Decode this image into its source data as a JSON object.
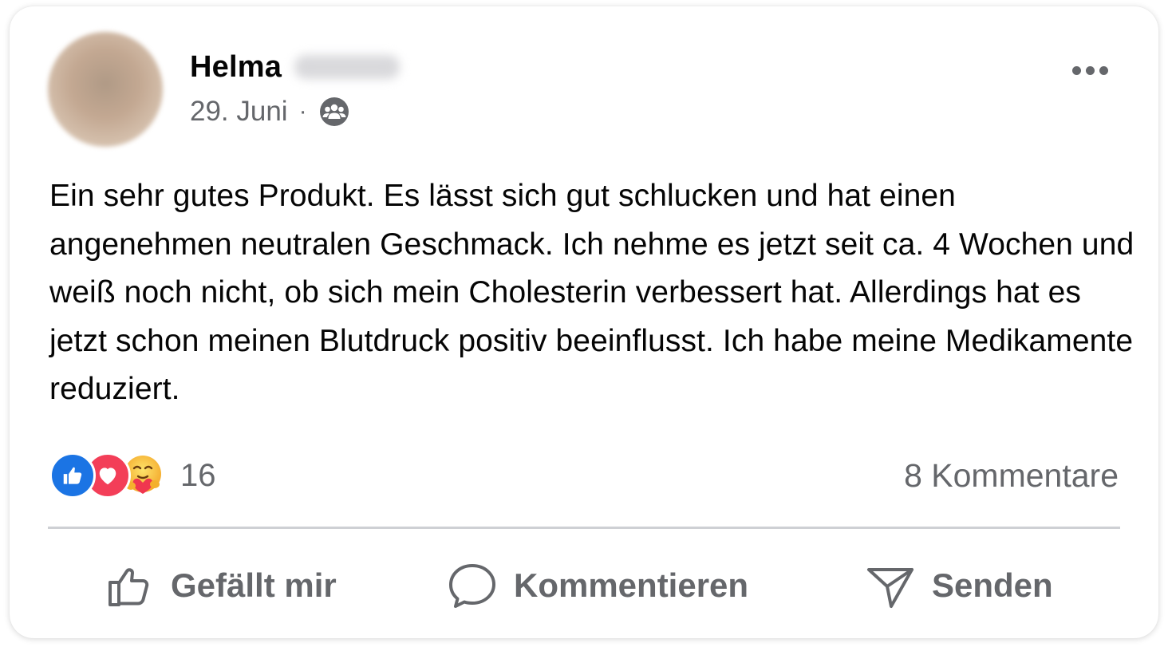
{
  "post": {
    "author_name": "Helma",
    "date": "29. Juni",
    "separator": "·",
    "audience_icon": "group-audience-icon",
    "more_icon": "more-options-icon",
    "text": "Ein sehr gutes Produkt. Es lässt sich gut schlucken und hat einen angenehmen neutralen Geschmack. Ich nehme es jetzt seit ca. 4 Wochen und weiß noch nicht, ob sich mein Cholesterin verbessert hat. Allerdings hat es jetzt schon meinen Blutdruck positiv beeinflusst. Ich habe meine Medikamente reduziert."
  },
  "engagement": {
    "reactions": [
      "like-reaction-icon",
      "love-reaction-icon",
      "care-reaction-icon"
    ],
    "reaction_count": "16",
    "comments": "8 Kommentare"
  },
  "actions": {
    "like_label": "Gefällt mir",
    "comment_label": "Kommentieren",
    "send_label": "Senden"
  },
  "colors": {
    "text": "#050505",
    "secondary_text": "#65676b",
    "like_blue": "#1b74e4",
    "love_red": "#f33e58",
    "divider": "#ced0d4"
  }
}
